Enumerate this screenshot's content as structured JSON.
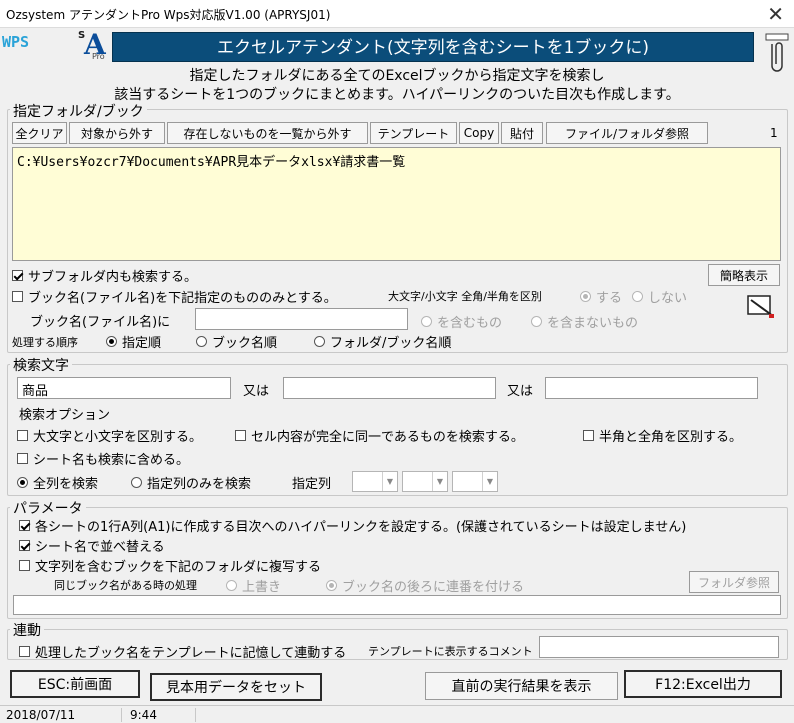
{
  "window": {
    "title": "Ozsystem アテンダントPro Wps対応版V1.00 (APRYSJ01)"
  },
  "logo": {
    "wps": "WPS",
    "s": "S",
    "a": "A",
    "pro": "Pro"
  },
  "banner": {
    "title": "エクセルアテンダント(文字列を含むシートを1ブックに)"
  },
  "description": {
    "line1": "指定したフォルダにある全てのExcelブックから指定文字を検索し",
    "line2": "該当するシートを1つのブックにまとめます。ハイパーリンクのついた目次も作成します。"
  },
  "folder_section": {
    "legend": "指定フォルダ/ブック",
    "buttons": {
      "clear_all": "全クリア",
      "remove": "対象から外す",
      "remove_missing": "存在しないものを一覧から外す",
      "template": "テンプレート",
      "copy": "Copy",
      "paste": "貼付",
      "browse": "ファイル/フォルダ参照"
    },
    "count": "1",
    "path_list": "C:¥Users¥ozcr7¥Documents¥APR見本データxlsx¥請求書一覧",
    "subfolder_label": "サブフォルダ内も検索する。",
    "brief_button": "簡略表示",
    "bookname_only_label": "ブック名(ファイル名)を下記指定のもののみとする。",
    "case_label": "大文字/小文字 全角/半角を区別",
    "case_yes": "する",
    "case_no": "しない",
    "bookname_label": "ブック名(ファイル名)に",
    "bookname_value": "",
    "contains": "を含むもの",
    "not_contains": "を含まないもの",
    "order_label": "処理する順序",
    "order_specified": "指定順",
    "order_book": "ブック名順",
    "order_folder_book": "フォルダ/ブック名順"
  },
  "search_section": {
    "legend": "検索文字",
    "term1": "商品",
    "or1": "又は",
    "term2": "",
    "or2": "又は",
    "term3": "",
    "options_label": "検索オプション",
    "case_sensitive": "大文字と小文字を区別する。",
    "whole_cell": "セル内容が完全に同一であるものを検索する。",
    "width_sensitive": "半角と全角を区別する。",
    "include_sheet_name": "シート名も検索に含める。",
    "all_columns": "全列を検索",
    "specified_columns": "指定列のみを検索",
    "column_label": "指定列"
  },
  "param_section": {
    "legend": "パラメータ",
    "hyperlink": "各シートの1行A列(A1)に作成する目次へのハイパーリンクを設定する。(保護されているシートは設定しません)",
    "sort_by_sheet": "シート名で並べ替える",
    "copy_books": "文字列を含むブックを下記のフォルダに複写する",
    "same_name_label": "同じブック名がある時の処理",
    "overwrite": "上書き",
    "append_number": "ブック名の後ろに連番を付ける",
    "folder_browse": "フォルダ参照",
    "folder_path": ""
  },
  "link_section": {
    "legend": "連動",
    "remember": "処理したブック名をテンプレートに記憶して連動する",
    "comment_label": "テンプレートに表示するコメント",
    "comment_value": ""
  },
  "bottom_buttons": {
    "esc": "ESC:前画面",
    "sample": "見本用データをセット",
    "last_result": "直前の実行結果を表示",
    "f12": "F12:Excel出力"
  },
  "status": {
    "date": "2018/07/11",
    "time": "9:44"
  },
  "colors": {
    "banner": "#0b4d7a",
    "path_bg": "#fffdd6",
    "wps": "#2aa3d8"
  }
}
